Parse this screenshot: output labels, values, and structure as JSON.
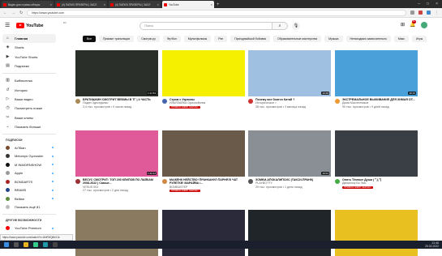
{
  "browser": {
    "tabs": [
      {
        "label": "Видео для стримы обзоры"
      },
      {
        "label": "(4) ПАПИЧ ПРИЗЕРЫ | ЗАСЛ"
      },
      {
        "label": "(4) ПАПИЧ ПРИЗЕРЫ | ЗАСЛ"
      },
      {
        "label": "YouTube"
      }
    ],
    "active_tab": 3,
    "url": "https://www.youtube.com"
  },
  "header": {
    "logo_text": "YouTube",
    "logo_region": "RU",
    "search_placeholder": "Поиск",
    "notifications_badge": "9+"
  },
  "sidebar": {
    "main": [
      {
        "label": "Главная",
        "icon": "home-icon",
        "glyph": "⌂"
      },
      {
        "label": "Shorts",
        "icon": "shorts-icon",
        "glyph": "◈"
      },
      {
        "label": "YouTube Shorts",
        "icon": "shorts-icon",
        "glyph": "▶"
      },
      {
        "label": "Подписки",
        "icon": "subscriptions-icon",
        "glyph": "▤"
      }
    ],
    "library": [
      {
        "label": "Библиотека",
        "icon": "library-icon",
        "glyph": "▥"
      },
      {
        "label": "История",
        "icon": "history-icon",
        "glyph": "↺"
      },
      {
        "label": "Ваши видео",
        "icon": "your-videos-icon",
        "glyph": "▷"
      },
      {
        "label": "Посмотреть позже",
        "icon": "watch-later-icon",
        "glyph": "◷"
      },
      {
        "label": "Ваши клипы",
        "icon": "clips-icon",
        "glyph": "✂"
      },
      {
        "label": "Показать больше",
        "icon": "chevron-down-icon",
        "glyph": "⌄"
      }
    ],
    "subs_heading": "ПОДПИСКИ",
    "subscriptions": [
      {
        "label": "ArTikan",
        "color": "#7a4b2a"
      },
      {
        "label": "Melomyn Gyoroskin",
        "color": "#333333"
      },
      {
        "label": "M INMORNSHOW",
        "color": "#111111"
      },
      {
        "label": "Apple",
        "color": "#999999"
      },
      {
        "label": "BONDARTS",
        "color": "#aa2222"
      },
      {
        "label": "BRAMS",
        "color": "#224488"
      },
      {
        "label": "Bellian",
        "color": "#5a8a3a"
      },
      {
        "label": "Показать ещё 81",
        "color": "#bbbbbb"
      }
    ],
    "more_heading": "ДРУГИЕ ВОЗМОЖНОСТИ",
    "more": [
      {
        "label": "YouTube Premium",
        "color": "#ff0000"
      }
    ]
  },
  "chips": [
    "Все",
    "Прямые трансляции",
    "Смотрю.ру",
    "Футбол",
    "Мультфильмы",
    "Рэп",
    "Пригодныйшой бойовик",
    "Образовательные мастерства",
    "Музыка",
    "Ненаходимо заявочительно",
    "Микс",
    "Игры"
  ],
  "videos": [
    {
      "title": "БРАТИШКИН СМОТРИТ ВЕБМЫ В ТГ | 4 ЧАСТЬ",
      "channel": "Падин Здеседанко",
      "stats": "3,4 тыс. просмотров • 9 часов назад",
      "avatar_color": "#a85",
      "thumb": "#2a2f2a",
      "duration": "1:21:53",
      "live": ""
    },
    {
      "title": "Стрим с Украины",
      "channel": "ИЛЬЯЗАЙКА Оризнойэлик",
      "stats": "",
      "avatar_color": "#46a",
      "thumb": "#f4f000",
      "duration": "",
      "live": "ПРЯМОЙ ЭФИР СЕЙЧАС"
    },
    {
      "title": "Почему все боятся Китай ?",
      "channel": "Историческое •",
      "stats": "38 тыс. просмотров • 3 месяца назад",
      "avatar_color": "#c33",
      "thumb": "#9fc0e0",
      "duration": "10:48",
      "live": ""
    },
    {
      "title": "ЭКСТРЕМАЛЬНОЕ ВЫЖИВАНИЕ ДЛЯ ЗИМАЯ ОТ...",
      "channel": "Дима Масленников",
      "stats": "90 тыс. просмотров • 9 дней назад",
      "avatar_color": "#e93",
      "thumb": "#4aa0d8",
      "duration": "28:15",
      "live": ""
    },
    {
      "title": "ВЕСУС СМОТРИТ: ТОП 200 КЛИПОВ ПО ЛАЙКАМ 2008-2022 | Самые...",
      "channel": "VESUS 003",
      "stats": "27 тыс. просмотров • 2 дня назад",
      "avatar_color": "#933",
      "thumb": "#e05a9a",
      "duration": "1:22:44",
      "live": ""
    },
    {
      "title": "МАЖЕНК НЕЙСТВО! ПРАНКАНУЛ ПАРНЯ В ЧАТ РУЛЕТКЕ! МАРАЙВА /...",
      "channel": "BOMBASTEP",
      "stats": "",
      "avatar_color": "#c84",
      "thumb": "#6a5a4a",
      "duration": "",
      "live": "ПРЯМОЙ ЭФИР СЕЙЧАС"
    },
    {
      "title": "ЗОМБИ-АПОКАЛИПСИС (ТАКСИ-ПРАНК)",
      "channel": "PLAYBOTTY",
      "stats": "29 тыс. просмотров • 1 день назад",
      "avatar_color": "#555",
      "thumb": "#8a8f95",
      "duration": "10:01",
      "live": ""
    },
    {
      "title": "Опять Тёмные Души ( ͡° ͜ʖ ͡°)",
      "channel": "Движенок Би Эмс",
      "stats": "",
      "avatar_color": "#4a4",
      "thumb": "#3a3f45",
      "duration": "",
      "live": "ПРЯМОЙ ЭФИР СЕЙЧАС"
    },
    {
      "title": "",
      "channel": "",
      "stats": "",
      "avatar_color": "#888",
      "thumb": "#8a7a60",
      "duration": "",
      "live": ""
    },
    {
      "title": "",
      "channel": "",
      "stats": "",
      "avatar_color": "#888",
      "thumb": "#2a2a3a",
      "duration": "",
      "live": ""
    },
    {
      "title": "",
      "channel": "",
      "stats": "",
      "avatar_color": "#888",
      "thumb": "#20252a",
      "duration": "",
      "live": ""
    },
    {
      "title": "",
      "channel": "",
      "stats": "",
      "avatar_color": "#888",
      "thumb": "#e8c020",
      "duration": "",
      "live": ""
    }
  ],
  "status_url": "https://www.youtube.com/watch?v=lAhFMQ6bX1k",
  "taskbar": {
    "time": "21:46",
    "date": "25.02.2022"
  }
}
